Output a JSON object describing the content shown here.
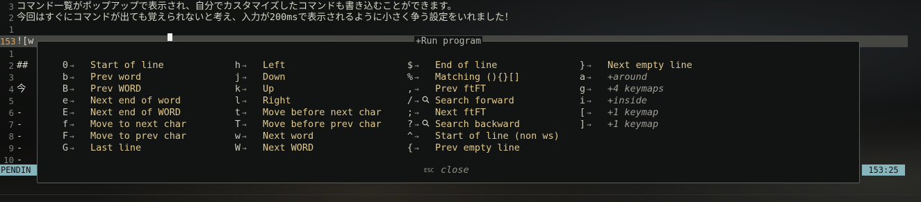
{
  "editor": {
    "lines": [
      {
        "num": "3",
        "text": "コマンド一覧がポップアップで表示され、自分でカスタマイズしたコマンドも書き込むことができます。"
      },
      {
        "num": "2",
        "text": "今回はすぐにコマンドが出ても覚えられないと考え、入力が200msで表示されるように小さく争う設定をいれました！"
      },
      {
        "num": "1",
        "text": ""
      },
      {
        "num": "153",
        "text": "![w"
      },
      {
        "num": "1",
        "text": ""
      },
      {
        "num": "2",
        "text": "##"
      },
      {
        "num": "3",
        "text": ""
      },
      {
        "num": "4",
        "text": "今"
      },
      {
        "num": "5",
        "text": ""
      },
      {
        "num": "6",
        "text": "-"
      },
      {
        "num": "7",
        "text": "-"
      },
      {
        "num": "8",
        "text": "-"
      },
      {
        "num": "9",
        "text": "-"
      },
      {
        "num": "10",
        "text": "-"
      }
    ]
  },
  "status": {
    "mode": "PENDIN",
    "position": "153:25"
  },
  "popup": {
    "title": "+Run program",
    "columns": [
      [
        {
          "key": "0",
          "desc": "Start of line",
          "group": false,
          "icon": ""
        },
        {
          "key": "b",
          "desc": "Prev word",
          "group": false,
          "icon": ""
        },
        {
          "key": "B",
          "desc": "Prev WORD",
          "group": false,
          "icon": ""
        },
        {
          "key": "e",
          "desc": "Next end of word",
          "group": false,
          "icon": ""
        },
        {
          "key": "E",
          "desc": "Next end of WORD",
          "group": false,
          "icon": ""
        },
        {
          "key": "f",
          "desc": "Move to next char",
          "group": false,
          "icon": ""
        },
        {
          "key": "F",
          "desc": "Move to prev char",
          "group": false,
          "icon": ""
        },
        {
          "key": "G",
          "desc": "Last line",
          "group": false,
          "icon": ""
        }
      ],
      [
        {
          "key": "h",
          "desc": "Left",
          "group": false,
          "icon": ""
        },
        {
          "key": "j",
          "desc": "Down",
          "group": false,
          "icon": ""
        },
        {
          "key": "k",
          "desc": "Up",
          "group": false,
          "icon": ""
        },
        {
          "key": "l",
          "desc": "Right",
          "group": false,
          "icon": ""
        },
        {
          "key": "t",
          "desc": "Move before next char",
          "group": false,
          "icon": ""
        },
        {
          "key": "T",
          "desc": "Move before prev char",
          "group": false,
          "icon": ""
        },
        {
          "key": "w",
          "desc": "Next word",
          "group": false,
          "icon": ""
        },
        {
          "key": "W",
          "desc": "Next WORD",
          "group": false,
          "icon": ""
        }
      ],
      [
        {
          "key": "$",
          "desc": "End of line",
          "group": false,
          "icon": ""
        },
        {
          "key": "%",
          "desc": "Matching (){}[]",
          "group": false,
          "icon": ""
        },
        {
          "key": ",",
          "desc": "Prev ftFT",
          "group": false,
          "icon": ""
        },
        {
          "key": "/",
          "desc": "Search forward",
          "group": false,
          "icon": "search-icon"
        },
        {
          "key": ";",
          "desc": "Next ftFT",
          "group": false,
          "icon": ""
        },
        {
          "key": "?",
          "desc": "Search backward",
          "group": false,
          "icon": "search-icon"
        },
        {
          "key": "^",
          "desc": "Start of line (non ws)",
          "group": false,
          "icon": ""
        },
        {
          "key": "{",
          "desc": "Prev empty line",
          "group": false,
          "icon": ""
        }
      ],
      [
        {
          "key": "}",
          "desc": "Next empty line",
          "group": false,
          "icon": ""
        },
        {
          "key": "a",
          "desc": "+around",
          "group": true,
          "icon": ""
        },
        {
          "key": "g",
          "desc": "+4 keymaps",
          "group": true,
          "icon": ""
        },
        {
          "key": "i",
          "desc": "+inside",
          "group": true,
          "icon": ""
        },
        {
          "key": "[",
          "desc": "+1 keymap",
          "group": true,
          "icon": ""
        },
        {
          "key": "]",
          "desc": "+1 keymap",
          "group": true,
          "icon": ""
        }
      ]
    ],
    "arrow": "→",
    "esc_label": "ESC",
    "close_label": "close"
  },
  "colors": {
    "description": "#dfc98f",
    "group": "#9f9f96",
    "statusline": "#87b5bd",
    "current_line_number": "#e0a35c"
  }
}
